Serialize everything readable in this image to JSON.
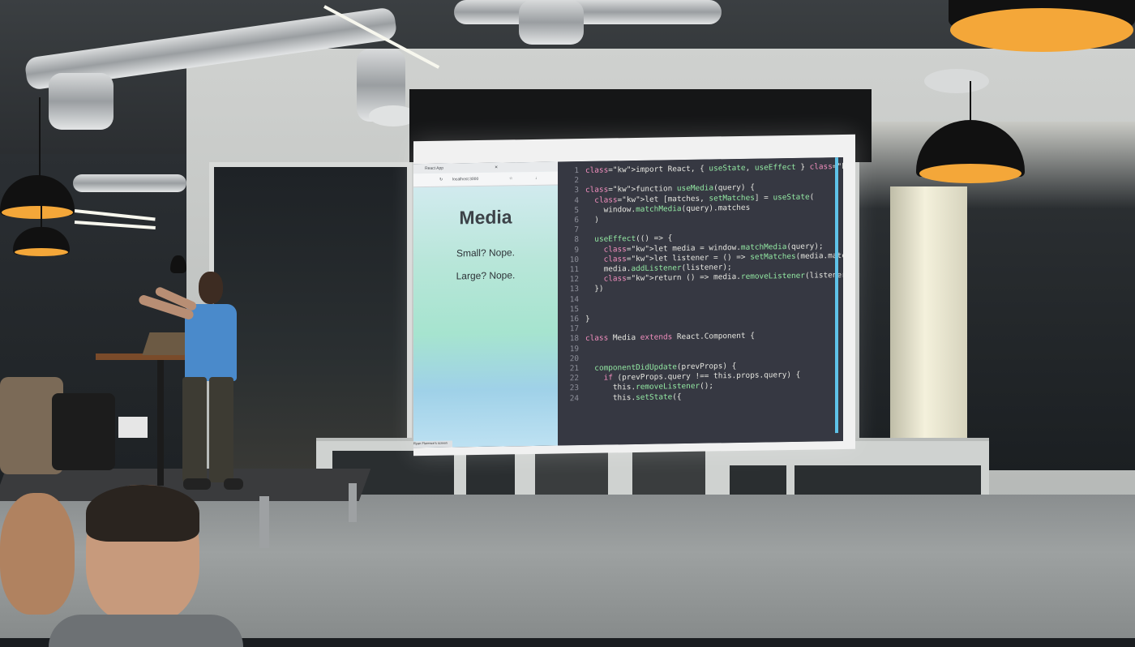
{
  "scene": {
    "description_free": true
  },
  "browser": {
    "tab_title": "React App",
    "url": "localhost:3000",
    "heading": "Media",
    "lines": [
      "Small? Nope.",
      "Large? Nope."
    ],
    "status_text": "Ryan Florence's screen"
  },
  "code": {
    "lines": [
      {
        "n": "1",
        "text": "import React, { useState, useEffect } from \"react\";"
      },
      {
        "n": "2",
        "text": ""
      },
      {
        "n": "3",
        "text": "function useMedia(query) {"
      },
      {
        "n": "4",
        "text": "  let [matches, setMatches] = useState("
      },
      {
        "n": "5",
        "text": "    window.matchMedia(query).matches"
      },
      {
        "n": "6",
        "text": "  )"
      },
      {
        "n": "7",
        "text": ""
      },
      {
        "n": "8",
        "text": "  useEffect(() => {"
      },
      {
        "n": "9",
        "text": "    let media = window.matchMedia(query);"
      },
      {
        "n": "10",
        "text": "    let listener = () => setMatches(media.matches)"
      },
      {
        "n": "11",
        "text": "    media.addListener(listener);"
      },
      {
        "n": "12",
        "text": "    return () => media.removeListener(listener);"
      },
      {
        "n": "13",
        "text": "  })"
      },
      {
        "n": "14",
        "text": ""
      },
      {
        "n": "15",
        "text": ""
      },
      {
        "n": "16",
        "text": "}"
      },
      {
        "n": "17",
        "text": ""
      },
      {
        "n": "18",
        "text": "class Media extends React.Component {"
      },
      {
        "n": "19",
        "text": ""
      },
      {
        "n": "20",
        "text": ""
      },
      {
        "n": "21",
        "text": "  componentDidUpdate(prevProps) {"
      },
      {
        "n": "22",
        "text": "    if (prevProps.query !== this.props.query) {"
      },
      {
        "n": "23",
        "text": "      this.removeListener();"
      },
      {
        "n": "24",
        "text": "      this.setState({"
      }
    ]
  },
  "colors": {
    "keyword": "#f38fbf",
    "function": "#92e7a2",
    "string": "#eadc8a",
    "lamp_glow": "#f4a739"
  }
}
